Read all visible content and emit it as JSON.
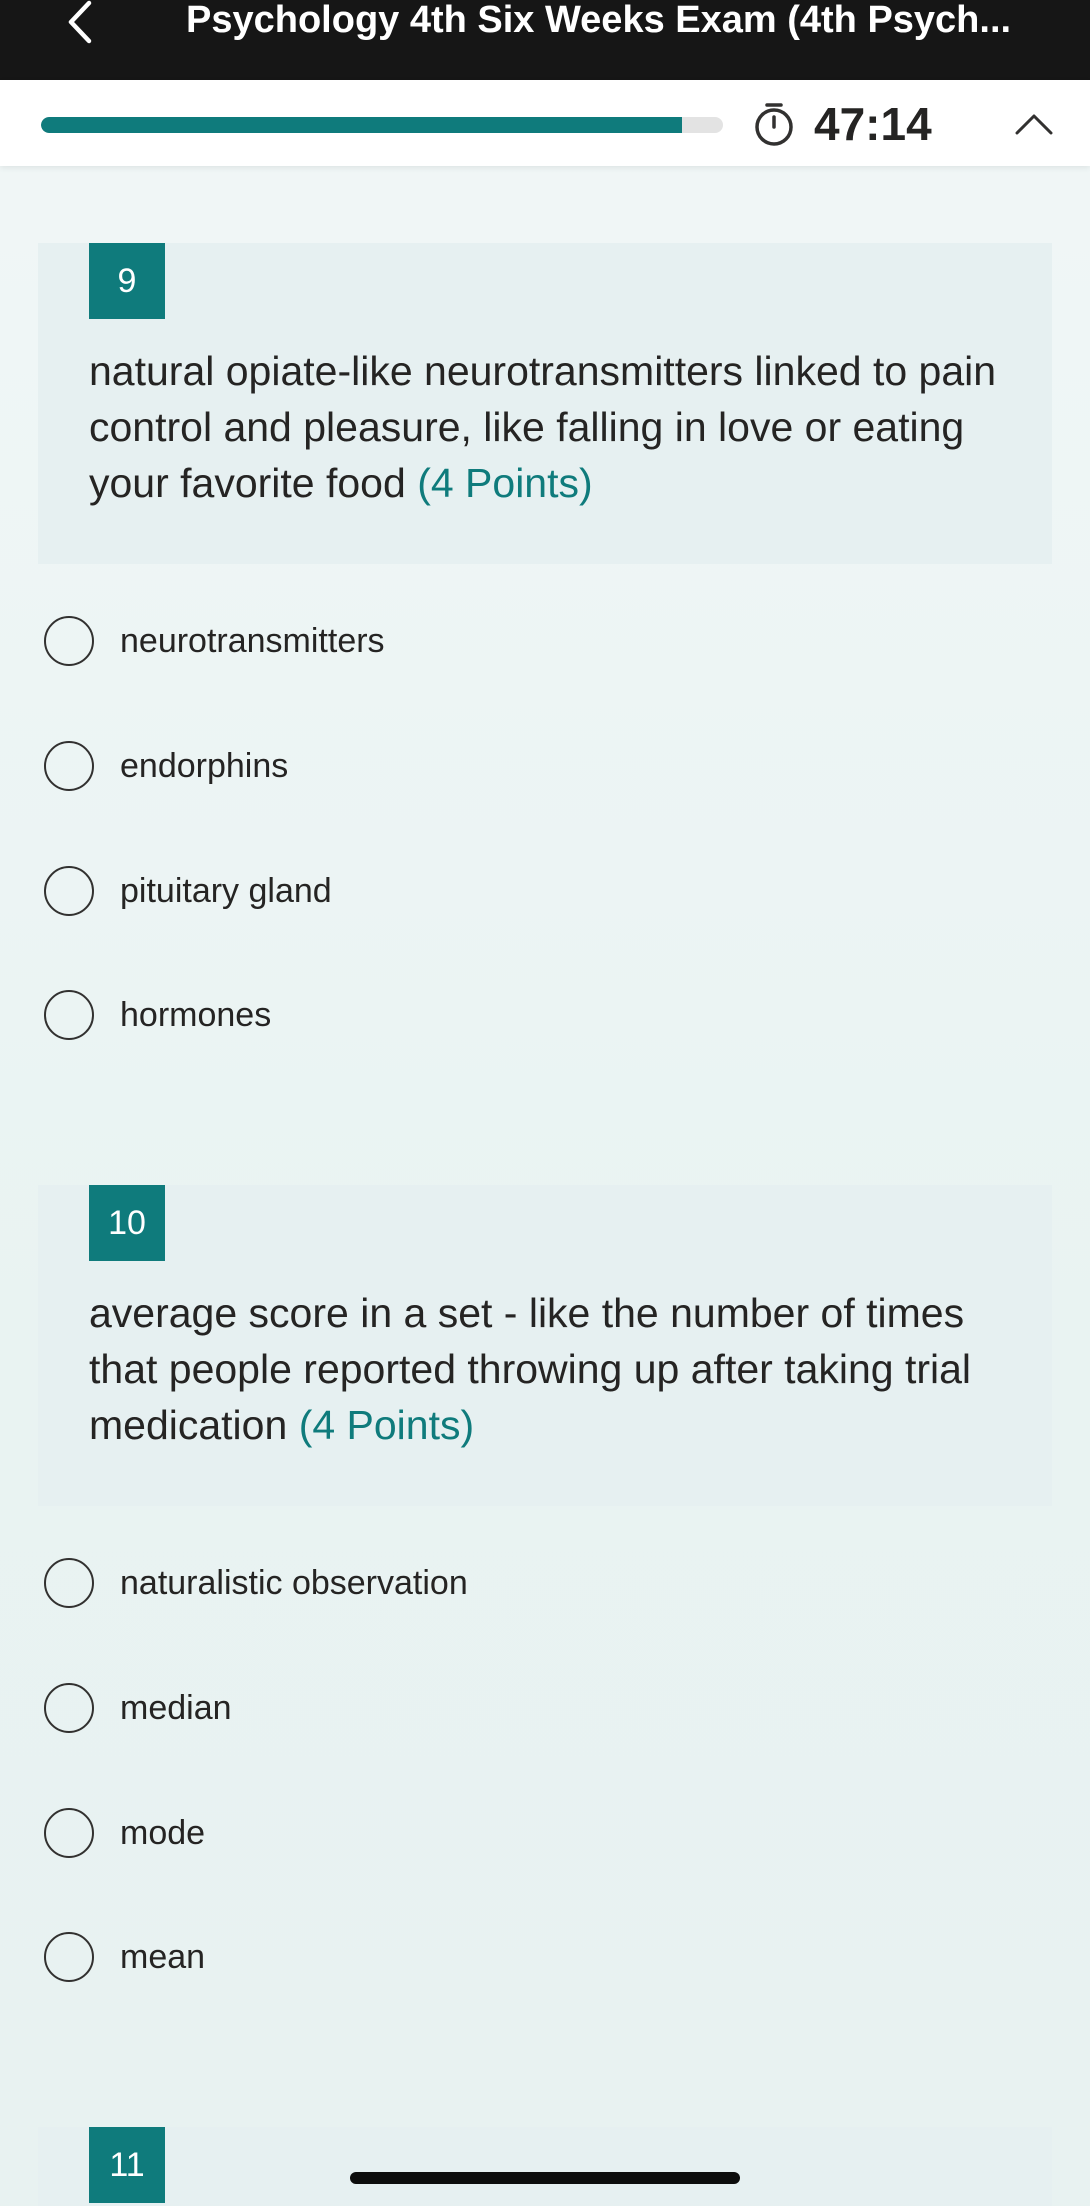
{
  "header": {
    "title": "Psychology 4th Six Weeks Exam (4th Psych...",
    "back_icon": "chevron-left-icon"
  },
  "status": {
    "progress_fraction": 0.94,
    "timer": "47:14",
    "timer_icon": "stopwatch-icon",
    "collapse_icon": "chevron-up-icon",
    "accent_color": "#0f7b7c"
  },
  "questions": [
    {
      "number": "9",
      "text": "natural opiate-like neurotransmitters linked to pain control and pleasure, like falling in love or eating your favorite food",
      "points": "(4 Points)",
      "options": [
        "neurotransmitters",
        "endorphins",
        "pituitary gland",
        "hormones"
      ]
    },
    {
      "number": "10",
      "text": "average score in a set - like the number of times that people reported throwing up after taking trial medication",
      "points": "(4 Points)",
      "options": [
        "naturalistic observation",
        "median",
        "mode",
        "mean"
      ]
    },
    {
      "number": "11"
    }
  ]
}
